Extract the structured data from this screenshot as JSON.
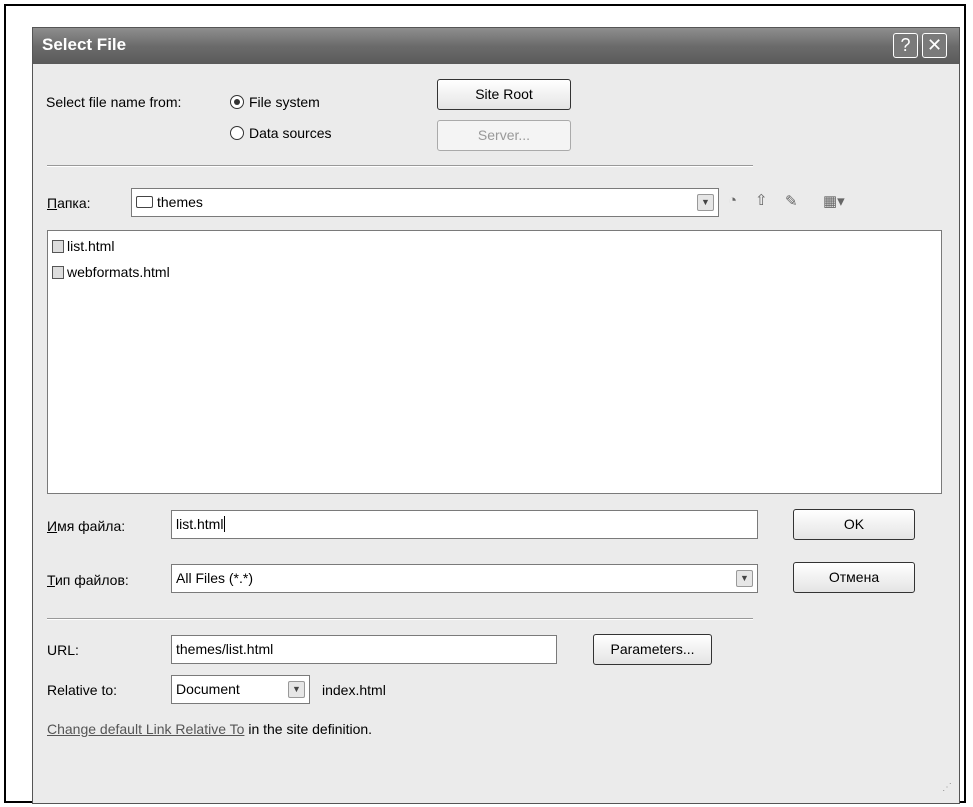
{
  "dialog": {
    "title": "Select File",
    "help_glyph": "?",
    "close_glyph": "✕"
  },
  "source": {
    "label": "Select file name from:",
    "file_system": "File system",
    "data_sources": "Data sources",
    "site_root_label": "Site Root",
    "server_label": "Server..."
  },
  "folder": {
    "label_ul": "П",
    "label_rest": "апка:",
    "current": "themes"
  },
  "files": [
    {
      "name": "list.html"
    },
    {
      "name": "webformats.html"
    }
  ],
  "filename": {
    "label_ul": "И",
    "label_rest": "мя файла:",
    "value": "list.html"
  },
  "filetype": {
    "label_ul": "Т",
    "label_rest": "ип файлов:",
    "value": "All Files (*.*)"
  },
  "buttons": {
    "ok": "OK",
    "cancel": "Отмена",
    "parameters": "Parameters..."
  },
  "url": {
    "label": "URL:",
    "value": "themes/list.html"
  },
  "relative": {
    "label": "Relative to:",
    "value": "Document",
    "file": "index.html"
  },
  "footer": {
    "link_text": "Change default Link Relative To",
    "rest_text": " in the site definition."
  },
  "icons": {
    "back": "◔",
    "up": "⇧",
    "new_folder": "✎",
    "view": "▦▾"
  }
}
